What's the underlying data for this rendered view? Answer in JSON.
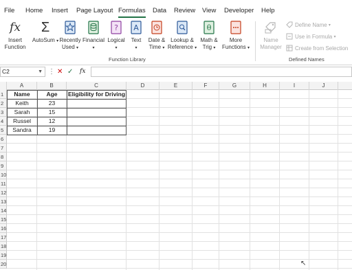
{
  "menu": {
    "tabs": [
      "File",
      "Home",
      "Insert",
      "Page Layout",
      "Formulas",
      "Data",
      "Review",
      "View",
      "Developer",
      "Help"
    ],
    "active": "Formulas"
  },
  "ribbon": {
    "function_library": {
      "insert_function": [
        "Insert",
        "Function"
      ],
      "autosum": "AutoSum",
      "recently_used": [
        "Recently",
        "Used"
      ],
      "financial": "Financial",
      "logical": "Logical",
      "text": "Text",
      "date_time": [
        "Date &",
        "Time"
      ],
      "lookup": [
        "Lookup &",
        "Reference"
      ],
      "math": [
        "Math &",
        "Trig"
      ],
      "more": [
        "More",
        "Functions"
      ],
      "label": "Function Library"
    },
    "defined_names": {
      "name_manager": [
        "Name",
        "Manager"
      ],
      "define_name": "Define Name",
      "use_in_formula": "Use in Formula",
      "create_from_selection": "Create from Selection",
      "label": "Defined Names"
    }
  },
  "formula_bar": {
    "name_box": "C2",
    "fx": "fx",
    "value": ""
  },
  "sheet": {
    "columns": [
      "A",
      "B",
      "C",
      "D",
      "E",
      "F",
      "G",
      "H",
      "I",
      "J"
    ],
    "rows": [
      "1",
      "2",
      "3",
      "4",
      "5",
      "6",
      "7",
      "8",
      "9",
      "10",
      "11",
      "12",
      "13",
      "14",
      "15",
      "16",
      "17",
      "18",
      "19",
      "20"
    ],
    "header": [
      "Name",
      "Age",
      "Eligibility for Driving"
    ],
    "data": [
      [
        "Keith",
        "23",
        ""
      ],
      [
        "Sarah",
        "15",
        ""
      ],
      [
        "Russel",
        "12",
        ""
      ],
      [
        "Sandra",
        "19",
        ""
      ]
    ]
  },
  "colors": {
    "accent": "#217346",
    "disabled": "#a8a8a8"
  },
  "icons": [
    "fx-icon",
    "sigma-icon",
    "star-book-icon",
    "financial-book-icon",
    "question-book-icon",
    "text-book-icon",
    "clock-book-icon",
    "lookup-book-icon",
    "theta-book-icon",
    "more-book-icon",
    "name-manager-icon",
    "tag-icon",
    "formula-icon",
    "selection-icon"
  ]
}
